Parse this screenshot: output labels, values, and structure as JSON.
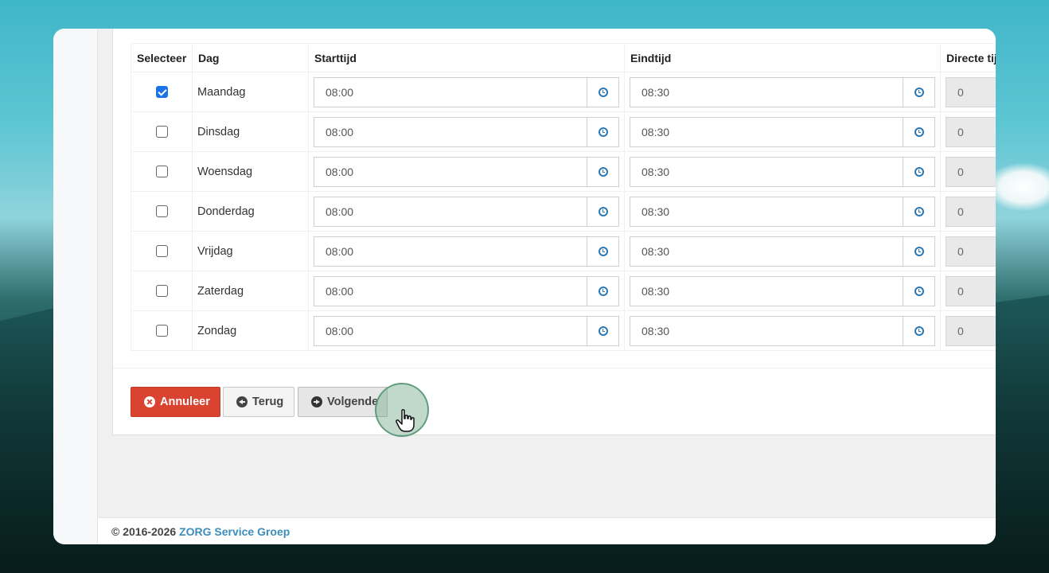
{
  "colors": {
    "danger": "#d9432f",
    "link": "#3c8dbc",
    "clock_icon": "#2a78b5",
    "checkbox_checked": "#1a73e8"
  },
  "table": {
    "headers": {
      "select": "Selecteer",
      "day": "Dag",
      "start": "Starttijd",
      "end": "Eindtijd",
      "direct": "Directe tij"
    },
    "rows": [
      {
        "day": "Maandag",
        "checked": true,
        "start": "08:00",
        "end": "08:30",
        "direct": "0"
      },
      {
        "day": "Dinsdag",
        "checked": false,
        "start": "08:00",
        "end": "08:30",
        "direct": "0"
      },
      {
        "day": "Woensdag",
        "checked": false,
        "start": "08:00",
        "end": "08:30",
        "direct": "0"
      },
      {
        "day": "Donderdag",
        "checked": false,
        "start": "08:00",
        "end": "08:30",
        "direct": "0"
      },
      {
        "day": "Vrijdag",
        "checked": false,
        "start": "08:00",
        "end": "08:30",
        "direct": "0"
      },
      {
        "day": "Zaterdag",
        "checked": false,
        "start": "08:00",
        "end": "08:30",
        "direct": "0"
      },
      {
        "day": "Zondag",
        "checked": false,
        "start": "08:00",
        "end": "08:30",
        "direct": "0"
      }
    ]
  },
  "buttons": {
    "cancel": {
      "label": "Annuleer",
      "icon": "times-circle-icon"
    },
    "back": {
      "label": "Terug",
      "icon": "arrow-circle-left-icon"
    },
    "next": {
      "label": "Volgende",
      "icon": "arrow-circle-right-icon"
    }
  },
  "footer": {
    "copyright": "© 2016-2026",
    "brand": "ZORG Service Groep"
  }
}
